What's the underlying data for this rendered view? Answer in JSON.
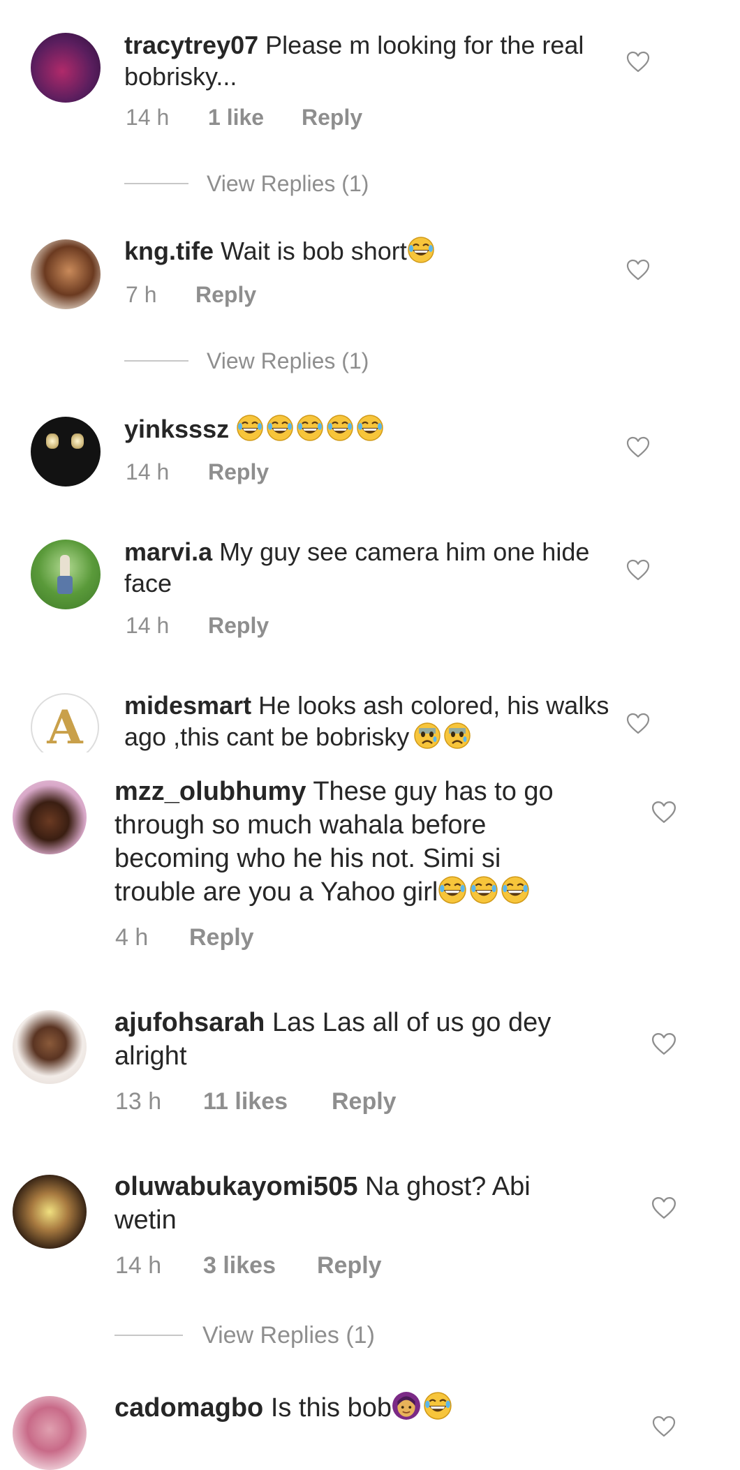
{
  "colors": {
    "text": "#262626",
    "muted": "#8e8e8e",
    "divider": "#c7c7c7"
  },
  "comments": [
    {
      "username": "tracytrey07",
      "text": "Please m looking for the real bobrisky...",
      "time": "14 h",
      "likes": "1 like",
      "reply": "Reply",
      "view_replies": "View Replies (1)"
    },
    {
      "username": "kng.tife",
      "text": "Wait is bob short",
      "time": "7 h",
      "reply": "Reply",
      "view_replies": "View Replies (1)"
    },
    {
      "username": "yinksssz",
      "text": "",
      "time": "14 h",
      "reply": "Reply"
    },
    {
      "username": "marvi.a",
      "text": "My guy see camera him one hide face",
      "time": "14 h",
      "reply": "Reply"
    },
    {
      "username": "midesmart",
      "text": "He looks ash colored, his walks ago ,this cant be bobrisky",
      "avatar_letter": "A"
    },
    {
      "username": "mzz_olubhumy",
      "text": "These guy has to go through so much wahala before becoming who he his not.  Simi si trouble are you a Yahoo girl",
      "time": "4 h",
      "reply": "Reply"
    },
    {
      "username": "ajufohsarah",
      "text": "Las Las all of us go dey alright",
      "time": "13 h",
      "likes": "11 likes",
      "reply": "Reply"
    },
    {
      "username": "oluwabukayomi505",
      "text": "Na ghost? Abi wetin",
      "time": "14 h",
      "likes": "3 likes",
      "reply": "Reply",
      "view_replies": "View Replies (1)"
    },
    {
      "username": "cadomagbo",
      "text": "Is this bob"
    }
  ]
}
